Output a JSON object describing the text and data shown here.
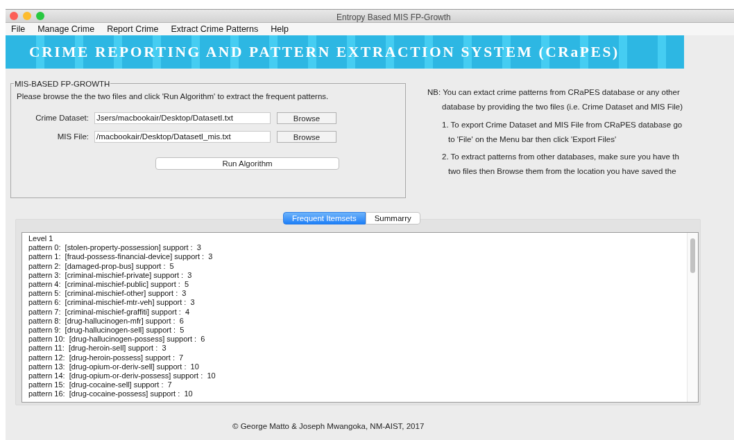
{
  "window": {
    "title": "Entropy Based MIS FP-Growth"
  },
  "menu": [
    "File",
    "Manage Crime",
    "Report Crime",
    "Extract Crime Patterns",
    "Help"
  ],
  "banner": "CRIME REPORTING AND PATTERN EXTRACTION SYSTEM (CRaPES)",
  "group": {
    "title": "MIS-BASED FP-GROWTH",
    "instructions": "Please browse the the two files and click 'Run Algorithm' to extract the frequent patterns.",
    "fields": [
      {
        "label": "Crime Dataset:",
        "value": "Jsers/macbookair/Desktop/DatasetI.txt",
        "button": "Browse"
      },
      {
        "label": "MIS File:",
        "value": "/macbookair/Desktop/DatasetI_mis.txt",
        "button": "Browse"
      }
    ],
    "run_button": "Run Algorithm"
  },
  "notes": [
    {
      "lines": [
        "NB: You can extact crime patterns from CRaPES database or any other",
        "database by providing the two files (i.e. Crime Dataset and MIS File)"
      ]
    },
    {
      "lines": [
        "1. To export Crime Dataset and MIS File from CRaPES database go",
        "to  'File' on the Menu bar then click 'Export Files'"
      ]
    },
    {
      "lines": [
        "2. To extract patterns from other databases, make sure you have th",
        "two files then Browse them from the location you have saved the"
      ]
    }
  ],
  "tabs": [
    {
      "label": "Frequent Itemsets",
      "selected": true
    },
    {
      "label": "Summarry",
      "selected": false
    }
  ],
  "output_lines": [
    "Level 1",
    "pattern 0:  [stolen-property-possession] support :  3",
    "pattern 1:  [fraud-possess-financial-device] support :  3",
    "pattern 2:  [damaged-prop-bus] support :  5",
    "pattern 3:  [criminal-mischief-private] support :  3",
    "pattern 4:  [criminal-mischief-public] support :  5",
    "pattern 5:  [criminal-mischief-other] support :  3",
    "pattern 6:  [criminal-mischief-mtr-veh] support :  3",
    "pattern 7:  [criminal-mischief-graffiti] support :  4",
    "pattern 8:  [drug-hallucinogen-mfr] support :  6",
    "pattern 9:  [drug-hallucinogen-sell] support :  5",
    "pattern 10:  [drug-hallucinogen-possess] support :  6",
    "pattern 11:  [drug-heroin-sell] support :  3",
    "pattern 12:  [drug-heroin-possess] support :  7",
    "pattern 13:  [drug-opium-or-deriv-sell] support :  10",
    "pattern 14:  [drug-opium-or-deriv-possess] support :  10",
    "pattern 15:  [drug-cocaine-sell] support :  7",
    "pattern 16:  [drug-cocaine-possess] support :  10"
  ],
  "footer": "© George Matto & Joseph Mwangoka, NM-AIST, 2017"
}
